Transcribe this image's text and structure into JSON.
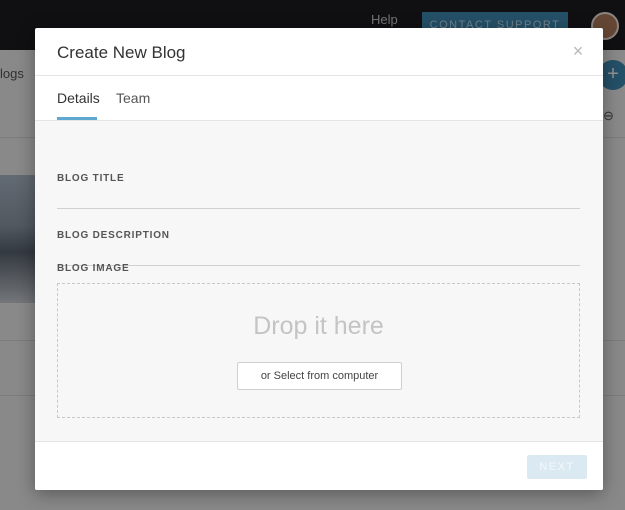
{
  "background": {
    "help_label": "Help",
    "contact_label": "CONTACT SUPPORT",
    "crumb": "logs",
    "fab_label": "+"
  },
  "modal": {
    "title": "Create New Blog",
    "close_label": "×",
    "tabs": [
      {
        "label": "Details",
        "active": true
      },
      {
        "label": "Team",
        "active": false
      }
    ],
    "fields": {
      "blog_title_label": "BLOG TITLE",
      "blog_title_value": "",
      "blog_description_label": "BLOG DESCRIPTION",
      "blog_description_value": "",
      "blog_image_label": "BLOG IMAGE"
    },
    "dropzone": {
      "drop_text": "Drop it here",
      "select_label": "or Select from computer"
    },
    "footer": {
      "next_label": "NEXT"
    }
  },
  "colors": {
    "accent": "#5fa9d0",
    "next_disabled": "#dbeaf2",
    "topbar": "#1d1d1f"
  }
}
